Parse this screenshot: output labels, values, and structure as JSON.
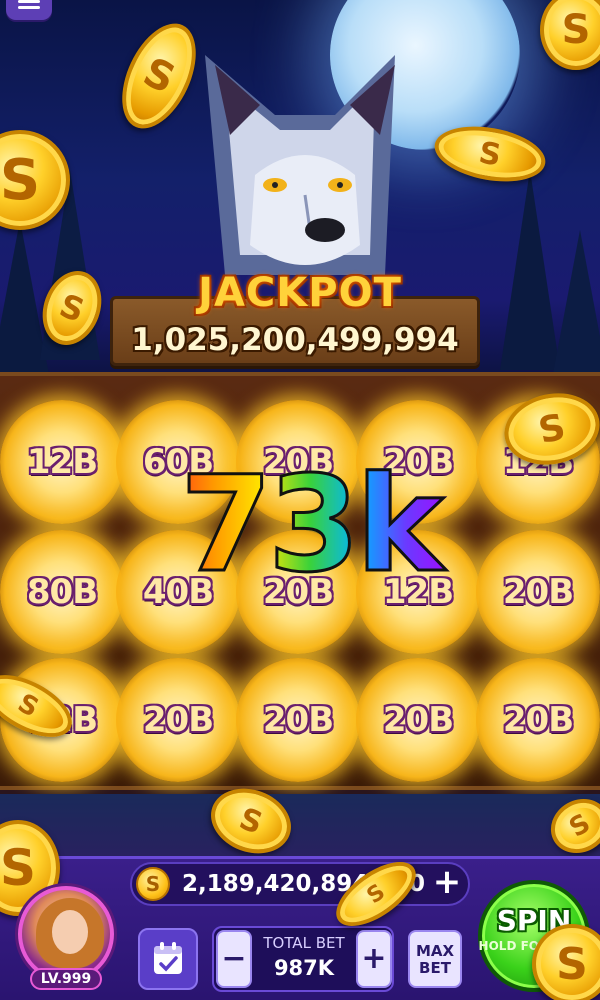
{
  "jackpot": {
    "title": "JACKPOT",
    "amount": "1,025,200,499,994"
  },
  "reels": {
    "rows": [
      [
        "12B",
        "60B",
        "20B",
        "20B",
        "12B"
      ],
      [
        "80B",
        "40B",
        "20B",
        "12B",
        "20B"
      ],
      [
        "12B",
        "20B",
        "20B",
        "20B",
        "20B"
      ]
    ]
  },
  "win_overlay": {
    "text": "73k"
  },
  "balance": {
    "amount": "2,189,420,894,990",
    "coin_glyph": "S",
    "plus_label": "+"
  },
  "player": {
    "level": "LV.999"
  },
  "bet": {
    "label": "TOTAL BET",
    "value": "987K",
    "minus_label": "−",
    "plus_label": "+",
    "max_bet_label": "MAX BET"
  },
  "spin": {
    "label": "SPIN",
    "sublabel": "HOLD FOR AUTO"
  },
  "colors": {
    "hud": "#3a1f8a",
    "spin": "#3ad21a",
    "jackpot_text": "#ffd23a"
  }
}
